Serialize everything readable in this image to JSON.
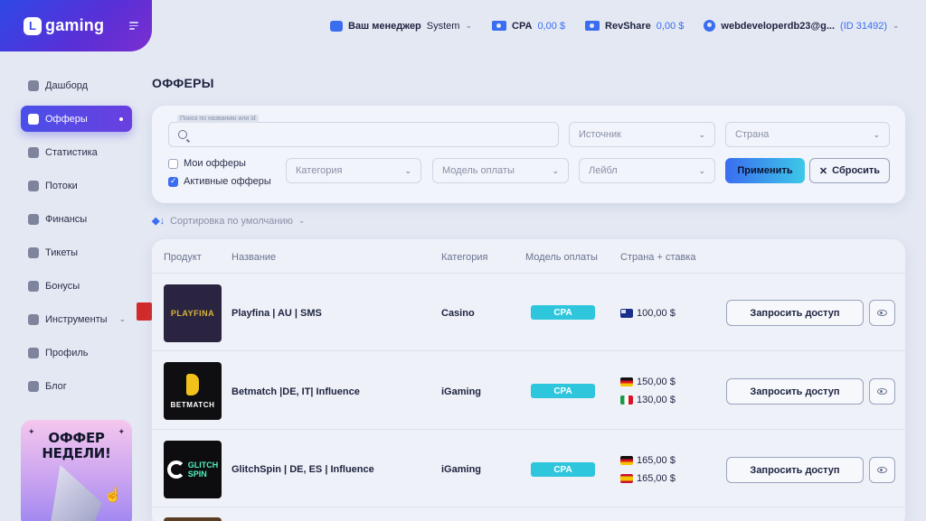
{
  "brand": {
    "logo_letter": "L",
    "name": "gaming"
  },
  "topnav": {
    "manager_label": "Ваш менеджер",
    "manager_name": "System",
    "cpa_label": "CPA",
    "cpa_value": "0,00 $",
    "revshare_label": "RevShare",
    "revshare_value": "0,00 $",
    "account_email": "webdeveloperdb23@g...",
    "account_id": "(ID 31492)"
  },
  "sidebar": {
    "items": [
      {
        "label": "Дашборд",
        "icon": "dashboard-icon"
      },
      {
        "label": "Офферы",
        "icon": "offers-icon",
        "active": true
      },
      {
        "label": "Статистика",
        "icon": "statistics-icon"
      },
      {
        "label": "Потоки",
        "icon": "streams-icon"
      },
      {
        "label": "Финансы",
        "icon": "finance-icon"
      },
      {
        "label": "Тикеты",
        "icon": "tickets-icon"
      },
      {
        "label": "Бонусы",
        "icon": "bonus-icon"
      },
      {
        "label": "Инструменты",
        "icon": "tools-icon",
        "has_dropdown": true
      },
      {
        "label": "Профиль",
        "icon": "profile-icon"
      },
      {
        "label": "Блог",
        "icon": "blog-icon"
      }
    ],
    "promo_line1": "ОФФЕР",
    "promo_line2": "НЕДЕЛИ!"
  },
  "page": {
    "title": "ОФФЕРЫ"
  },
  "filters": {
    "search_label": "Поиск по названию или id",
    "source_placeholder": "Источник",
    "country_placeholder": "Страна",
    "category_placeholder": "Категория",
    "payment_placeholder": "Модель оплаты",
    "label_placeholder": "Лейбл",
    "my_offers": "Мои офферы",
    "active_offers": "Активные офферы",
    "apply": "Применить",
    "reset": "Сбросить"
  },
  "sort": {
    "label": "Сортировка по умолчанию"
  },
  "table": {
    "headers": {
      "product": "Продукт",
      "name": "Название",
      "category": "Категория",
      "payment": "Модель оплаты",
      "country_rate": "Страна + ставка"
    },
    "rows": [
      {
        "logo_text": "PLAYFINA",
        "name": "Playfina | AU | SMS",
        "category": "Casino",
        "payment": "CPA",
        "rates": [
          {
            "flag": "au",
            "value": "100,00 $"
          }
        ],
        "request": "Запросить доступ"
      },
      {
        "logo_text": "BETMATCH",
        "name": "Betmatch |DE, IT| Influence",
        "category": "iGaming",
        "payment": "CPA",
        "rates": [
          {
            "flag": "de",
            "value": "150,00 $"
          },
          {
            "flag": "it",
            "value": "130,00 $"
          }
        ],
        "request": "Запросить доступ"
      },
      {
        "logo_text": "GLITCH SPIN",
        "logo_line1": "GLITCH",
        "logo_line2": "SPIN",
        "name": "GlitchSpin | DE, ES | Influence",
        "category": "iGaming",
        "payment": "CPA",
        "rates": [
          {
            "flag": "de",
            "value": "165,00 $"
          },
          {
            "flag": "es",
            "value": "165,00 $"
          }
        ],
        "request": "Запросить доступ"
      }
    ]
  },
  "colors": {
    "accent": "#3a6df0",
    "brand_gradient_start": "#2f48e6",
    "badge": "#2ec6dc"
  }
}
